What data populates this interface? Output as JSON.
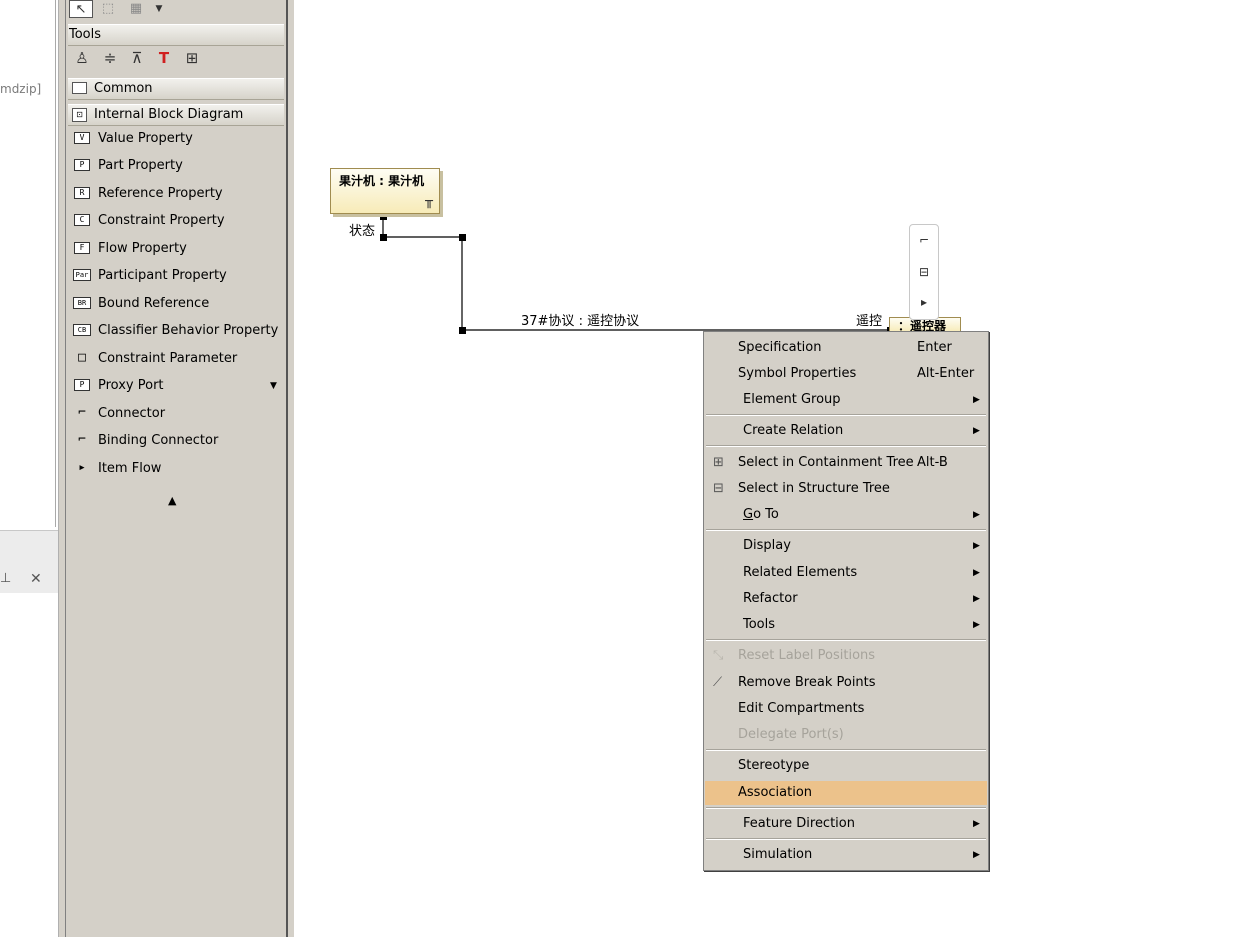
{
  "left_strip": {
    "project_suffix": "mdzip]",
    "pin_icon": "pin-icon",
    "close_icon": "close-icon"
  },
  "palette": {
    "toolbar": {
      "pointer": "pointer-icon",
      "lasso": "lasso-select-icon",
      "grid": "grid-select-icon",
      "dropdown": "dropdown-arrow-icon"
    },
    "tools_header": "Tools",
    "tool_icons": [
      "person-icon",
      "align-horizontal-icon",
      "align-vertical-icon",
      "text-icon",
      "layout-icon"
    ],
    "sections": {
      "common": "Common",
      "ibd": "Internal Block Diagram"
    },
    "items": [
      {
        "icon": "V",
        "label": "Value Property"
      },
      {
        "icon": "P",
        "label": "Part Property"
      },
      {
        "icon": "R",
        "label": "Reference Property"
      },
      {
        "icon": "C",
        "label": "Constraint Property"
      },
      {
        "icon": "F",
        "label": "Flow Property"
      },
      {
        "icon": "Par",
        "label": "Participant Property"
      },
      {
        "icon": "BR",
        "label": "Bound Reference"
      },
      {
        "icon": "CB",
        "label": "Classifier Behavior Property"
      },
      {
        "icon": "□",
        "label": "Constraint Parameter"
      },
      {
        "icon": "P",
        "label": "Proxy Port"
      },
      {
        "icon": "⌐",
        "label": "Connector"
      },
      {
        "icon": "⌐",
        "label": "Binding Connector"
      },
      {
        "icon": "▸",
        "label": "Item Flow"
      }
    ],
    "collapse_icon": "triangle-up-icon"
  },
  "diagram": {
    "part_juicer": "果汁机 : 果汁机",
    "part_remote": "：遥控器",
    "port_state": "状态",
    "connector_label": "37#协议 : 遥控协议",
    "port_remote": "遥控"
  },
  "context_menu": {
    "specification": {
      "label": "Specification",
      "shortcut": "Enter"
    },
    "symbol_properties": {
      "label": "Symbol Properties",
      "shortcut": "Alt-Enter"
    },
    "element_group": "Element Group",
    "create_relation": "Create Relation",
    "select_containment": {
      "label": "Select in Containment Tree",
      "shortcut": "Alt-B"
    },
    "select_structure": "Select in Structure Tree",
    "goto_prefix": "G",
    "goto_rest": "o To",
    "display": "Display",
    "related_elements": "Related Elements",
    "refactor": "Refactor",
    "tools": "Tools",
    "reset_label_positions": "Reset Label Positions",
    "remove_break_points": "Remove Break Points",
    "edit_compartments": "Edit Compartments",
    "delegate_ports": "Delegate Port(s)",
    "stereotype": "Stereotype",
    "association": "Association",
    "feature_direction": "Feature Direction",
    "simulation": "Simulation",
    "highlight_color": "#ecc28b"
  }
}
